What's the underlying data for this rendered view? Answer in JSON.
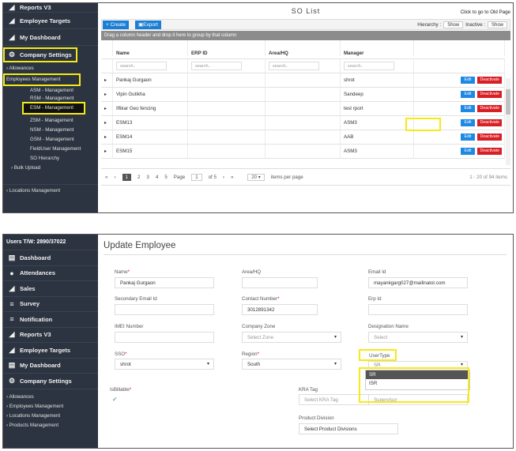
{
  "frame1": {
    "sidebar": {
      "items": [
        {
          "label": "Reports V3",
          "icon": "reports-icon"
        },
        {
          "label": "Employee Targets",
          "icon": "targets-icon"
        },
        {
          "label": "My Dashboard",
          "icon": "dashboard-icon"
        },
        {
          "label": "Company Settings",
          "icon": "settings-icon"
        }
      ],
      "sub": {
        "allowances": "Allowances",
        "employees_management": "Employees Management",
        "asm": "ASM - Management",
        "rsm": "RSM - Management",
        "esm": "ESM - Management",
        "zsm": "ZSM - Management",
        "nsm": "NSM - Management",
        "gsm": "GSM - Management",
        "fielduser": "FieldUser Management",
        "so_hierarchy": "SO Hierarchy",
        "bulk_upload": "Bulk Upload",
        "locations": "Locations Management"
      }
    },
    "title": "SO  List",
    "old_page_link": "Click to go to Old Page",
    "toolbar": {
      "create": "+ Create",
      "export": "Export",
      "hierarchy_label": "Hierarchy :",
      "hierarchy_toggle": "Show",
      "inactive_label": "Inactive :",
      "inactive_toggle": "Show"
    },
    "group_hint": "Drag a column header and drop it here to group by that column",
    "columns": [
      "Name",
      "ERP ID",
      "Area/HQ",
      "Manager"
    ],
    "filter_placeholder": "search..",
    "rows": [
      {
        "name": "Pankaj Gurgaon",
        "erp": "",
        "area": "",
        "manager": "shrot"
      },
      {
        "name": "Vipin Gutikha",
        "erp": "",
        "area": "",
        "manager": "Sandeep"
      },
      {
        "name": "Iftikar Geo fencing",
        "erp": "",
        "area": "",
        "manager": "test rport"
      },
      {
        "name": "ESM13",
        "erp": "",
        "area": "",
        "manager": "ASM3"
      },
      {
        "name": "ESM14",
        "erp": "",
        "area": "",
        "manager": "AAB"
      },
      {
        "name": "ESM15",
        "erp": "",
        "area": "",
        "manager": "ASM3"
      }
    ],
    "edit_label": "Edit",
    "deactivate_label": "Deactivate",
    "pager": {
      "first": "«",
      "prev": "‹",
      "pages": [
        "1",
        "2",
        "3",
        "4",
        "5"
      ],
      "page_word": "Page",
      "page_value": "1",
      "of_total": "of 5",
      "next": "›",
      "last": "»",
      "page_size": "20",
      "per_page": "items per page",
      "info": "1 - 20 of 94 items"
    }
  },
  "frame2": {
    "header": "Users T/W: 2890/37022",
    "sidebar": {
      "items": [
        {
          "label": "Dashboard",
          "icon": "dashboard-icon"
        },
        {
          "label": "Attendances",
          "icon": "user-icon"
        },
        {
          "label": "Sales",
          "icon": "sales-icon"
        },
        {
          "label": "Survey",
          "icon": "survey-icon"
        },
        {
          "label": "Notification",
          "icon": "notification-icon"
        },
        {
          "label": "Reports V3",
          "icon": "reports-icon"
        },
        {
          "label": "Employee Targets",
          "icon": "targets-icon"
        },
        {
          "label": "My Dashboard",
          "icon": "dashboard-icon"
        },
        {
          "label": "Company Settings",
          "icon": "settings-icon"
        }
      ],
      "sub": [
        "Allowances",
        "Employees Management",
        "Locations Management",
        "Products Management"
      ]
    },
    "title": "Update Employee",
    "fields": {
      "name_label": "Name",
      "name_value": "Pankaj Gurgaon",
      "area_label": "Area/HQ",
      "area_value": "",
      "email_label": "Email Id",
      "email_value": "mayankgarg027@mailinator.com",
      "secondary_email_label": "Secondary Email Id",
      "contact_label": "Contact Number",
      "contact_value": "3012891342",
      "erp_label": "Erp Id",
      "imei_label": "IMEI Number",
      "zone_label": "Company Zone",
      "zone_placeholder": "Select Zone",
      "designation_label": "Designation Name",
      "designation_placeholder": "Select",
      "sso_label": "SSO",
      "sso_value": "shrot",
      "region_label": "Region",
      "region_value": "South",
      "usertype_label": "UserType",
      "usertype_value": "SR",
      "billable_label": "IsBillable",
      "billable_check": "✓",
      "kra_label": "KRA Tag",
      "kra_placeholder": "Select KRA Tag",
      "supervisor_placeholder": "Supervisor",
      "product_division_label": "Product Division",
      "product_division_placeholder": "Select Product Divisions",
      "required_mark": "*"
    },
    "usertype_options": [
      "SR",
      "ISR"
    ]
  }
}
